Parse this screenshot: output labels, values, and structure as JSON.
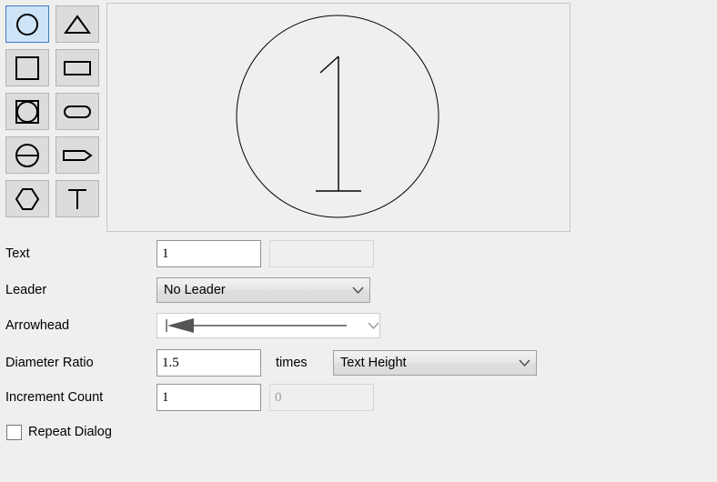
{
  "palette": {
    "tools": [
      {
        "name": "circle",
        "label": "Circle",
        "selected": true
      },
      {
        "name": "triangle",
        "label": "Triangle",
        "selected": false
      },
      {
        "name": "square",
        "label": "Square",
        "selected": false
      },
      {
        "name": "rectangle",
        "label": "Rectangle",
        "selected": false
      },
      {
        "name": "circle-in-box",
        "label": "Circle In Box",
        "selected": false
      },
      {
        "name": "stadium",
        "label": "Rounded Rectangle",
        "selected": false
      },
      {
        "name": "split-circle",
        "label": "Split Circle",
        "selected": false
      },
      {
        "name": "flag",
        "label": "Flag",
        "selected": false
      },
      {
        "name": "hexagon",
        "label": "Hexagon",
        "selected": false
      },
      {
        "name": "text-only",
        "label": "Text Only",
        "selected": false
      }
    ]
  },
  "preview": {
    "shape": "circle",
    "text": "1"
  },
  "form": {
    "text": {
      "label": "Text",
      "value": "1",
      "second_value": "",
      "second_placeholder": ""
    },
    "leader": {
      "label": "Leader",
      "value": "No Leader",
      "options": [
        "No Leader"
      ]
    },
    "arrowhead": {
      "label": "Arrowhead",
      "value": "filled-arrow"
    },
    "diameter_ratio": {
      "label": "Diameter Ratio",
      "value": "1.5",
      "times_label": "times",
      "units_value": "Text Height",
      "units_options": [
        "Text Height"
      ]
    },
    "increment_count": {
      "label": "Increment Count",
      "value": "1",
      "second_value": "0"
    },
    "repeat_dialog": {
      "label": "Repeat Dialog",
      "checked": false
    }
  },
  "colors": {
    "background": "#efefef",
    "selected_tool_fill": "#cde4f7",
    "selected_tool_border": "#3a7ebf",
    "button_face": "#dcdcdc",
    "stroke": "#000000"
  }
}
